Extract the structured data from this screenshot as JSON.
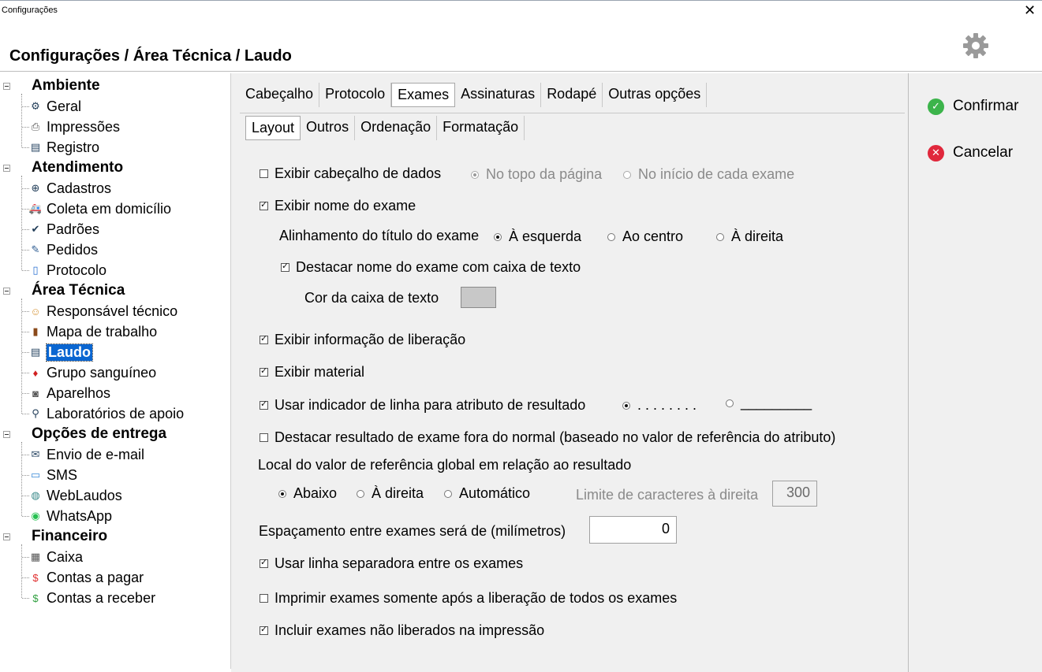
{
  "window": {
    "title": "Configurações",
    "close_glyph": "✕"
  },
  "header": {
    "breadcrumb": "Configurações / Área Técnica / Laudo",
    "settings_icon": "gear-icon"
  },
  "tree": {
    "groups": [
      {
        "label": "Ambiente",
        "items": [
          {
            "label": "Geral",
            "icon": "gear-icon"
          },
          {
            "label": "Impressões",
            "icon": "printer-icon"
          },
          {
            "label": "Registro",
            "icon": "document-icon"
          }
        ]
      },
      {
        "label": "Atendimento",
        "items": [
          {
            "label": "Cadastros",
            "icon": "plus-circle-icon"
          },
          {
            "label": "Coleta em domicílio",
            "icon": "ambulance-icon"
          },
          {
            "label": "Padrões",
            "icon": "check-circle-icon"
          },
          {
            "label": "Pedidos",
            "icon": "edit-icon"
          },
          {
            "label": "Protocolo",
            "icon": "file-icon"
          }
        ]
      },
      {
        "label": "Área Técnica",
        "items": [
          {
            "label": "Responsável técnico",
            "icon": "person-icon"
          },
          {
            "label": "Mapa de trabalho",
            "icon": "book-icon"
          },
          {
            "label": "Laudo",
            "icon": "report-icon"
          },
          {
            "label": "Grupo sanguíneo",
            "icon": "blood-drop-icon"
          },
          {
            "label": "Aparelhos",
            "icon": "device-icon"
          },
          {
            "label": "Laboratórios de apoio",
            "icon": "microscope-icon"
          }
        ]
      },
      {
        "label": "Opções de entrega",
        "items": [
          {
            "label": "Envio de e-mail",
            "icon": "envelope-icon"
          },
          {
            "label": "SMS",
            "icon": "sms-icon"
          },
          {
            "label": "WebLaudos",
            "icon": "globe-icon"
          },
          {
            "label": "WhatsApp",
            "icon": "whatsapp-icon"
          }
        ]
      },
      {
        "label": "Financeiro",
        "items": [
          {
            "label": "Caixa",
            "icon": "cash-register-icon"
          },
          {
            "label": "Contas a pagar",
            "icon": "dollar-red-icon"
          },
          {
            "label": "Contas a receber",
            "icon": "dollar-green-icon"
          }
        ]
      }
    ]
  },
  "tabs": [
    "Cabeçalho",
    "Protocolo",
    "Exames",
    "Assinaturas",
    "Rodapé",
    "Outras opções"
  ],
  "subtabs": [
    "Layout",
    "Outros",
    "Ordenação",
    "Formatação"
  ],
  "form": {
    "header_data": {
      "label": "Exibir cabeçalho de dados",
      "checked": false,
      "opt1": "No topo da página",
      "opt2": "No início de cada exame"
    },
    "exam_name": {
      "label": "Exibir nome do exame",
      "checked": true
    },
    "alignment": {
      "label": "Alinhamento do título do exame",
      "opt1": "À esquerda",
      "opt2": "Ao centro",
      "opt3": "À direita"
    },
    "highlight_name": {
      "label": "Destacar nome do exame com caixa de texto",
      "checked": true
    },
    "box_color": {
      "label": "Cor da caixa de texto",
      "value": "#c8c8c8"
    },
    "release_info": {
      "label": "Exibir informação de liberação",
      "checked": true
    },
    "material": {
      "label": "Exibir material",
      "checked": true
    },
    "line_indicator": {
      "label": "Usar indicador de linha para atributo de resultado",
      "checked": true,
      "opt1": ". . . . . . . .",
      "opt2": "_________"
    },
    "highlight_abnormal": {
      "label": "Destacar resultado de exame fora do normal (baseado no valor de referência do atributo)",
      "checked": false
    },
    "ref_location": {
      "label": "Local do valor de referência global em relação ao resultado",
      "opt1": "Abaixo",
      "opt2": "À direita",
      "opt3": "Automático",
      "limit_label": "Limite de caracteres à direita",
      "limit_value": "300"
    },
    "spacing": {
      "label": "Espaçamento entre exames será de (milímetros)",
      "value": "0"
    },
    "separator": {
      "label": "Usar linha separadora entre os exames",
      "checked": true
    },
    "print_after_release": {
      "label": "Imprimir exames somente após a liberação de todos os exames",
      "checked": false
    },
    "include_unreleased": {
      "label": "Incluir exames não liberados na impressão",
      "checked": true
    }
  },
  "actions": {
    "confirm": {
      "label": "Confirmar",
      "color": "#3cb44b"
    },
    "cancel": {
      "label": "Cancelar",
      "color": "#e0283c"
    }
  }
}
